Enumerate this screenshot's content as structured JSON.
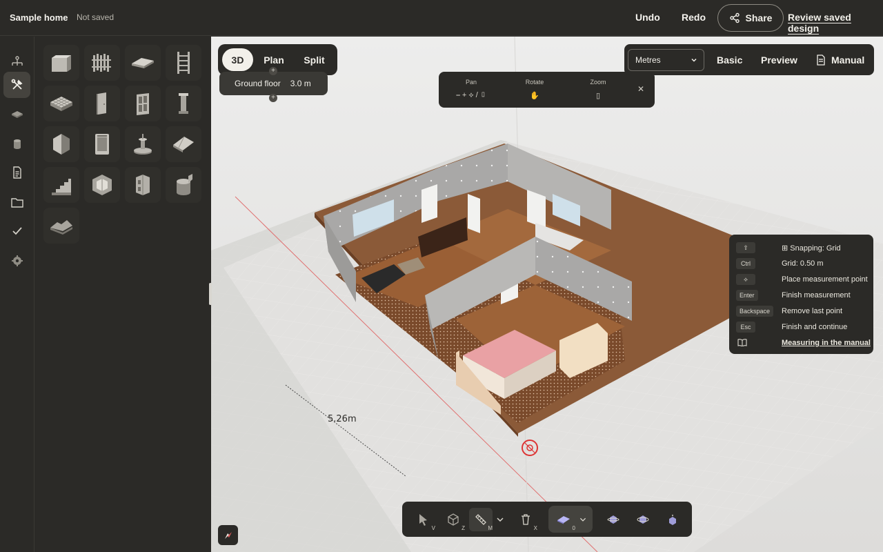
{
  "header": {
    "title": "Sample home",
    "status": "Not saved",
    "undo": "Undo",
    "redo": "Redo",
    "share": "Share",
    "review": "Review saved design"
  },
  "rail": {
    "items": [
      {
        "icon": "structure-icon"
      },
      {
        "icon": "build-tools-icon",
        "active": true
      },
      {
        "icon": "materials-icon"
      },
      {
        "icon": "paint-icon"
      },
      {
        "icon": "document-icon"
      },
      {
        "icon": "folder-icon"
      },
      {
        "icon": "check-icon"
      },
      {
        "icon": "settings-icon"
      }
    ]
  },
  "palette": {
    "items": [
      "wall-icon",
      "fence-icon",
      "slab-icon",
      "ladder-icon",
      "floor-grid-icon",
      "door-icon",
      "window-icon",
      "column-icon",
      "box-icon",
      "appliance-icon",
      "fountain-icon",
      "roof-icon",
      "stairs-icon",
      "room-icon",
      "cabinet-icon",
      "paint-bucket-icon",
      "terrain-icon"
    ]
  },
  "view": {
    "modes": [
      "3D",
      "Plan",
      "Split"
    ],
    "active": "3D",
    "floor_name": "Ground floor",
    "floor_height": "3.0 m",
    "add_above": "+",
    "add_below": "+"
  },
  "camera": {
    "pan": "Pan",
    "rotate": "Rotate",
    "zoom": "Zoom",
    "pan_glyphs": "⎯ + ⟡ / ▯",
    "close": "✕"
  },
  "options": {
    "units": "Metres",
    "basic": "Basic",
    "preview": "Preview",
    "manual": "Manual"
  },
  "shortcuts": {
    "rows": [
      {
        "key": "⇧",
        "label": "Snapping: Grid"
      },
      {
        "key": "Ctrl",
        "label": "Grid: 0.50 m"
      },
      {
        "key": "⟡",
        "label": "Place measurement point"
      },
      {
        "key": "Enter",
        "label": "Finish measurement"
      },
      {
        "key": "Backspace",
        "label": "Remove last point"
      },
      {
        "key": "Esc",
        "label": "Finish and continue"
      }
    ],
    "link": "Measuring in the manual"
  },
  "toolbar": {
    "tools": [
      {
        "name": "select-tool",
        "key": "V"
      },
      {
        "name": "orbit-tool",
        "key": "Z"
      },
      {
        "name": "measure-tool",
        "key": "M"
      },
      {
        "name": "delete-tool",
        "key": "X"
      },
      {
        "name": "floor-tool",
        "key": "0"
      }
    ]
  },
  "measurement": {
    "label": "5.26m"
  }
}
